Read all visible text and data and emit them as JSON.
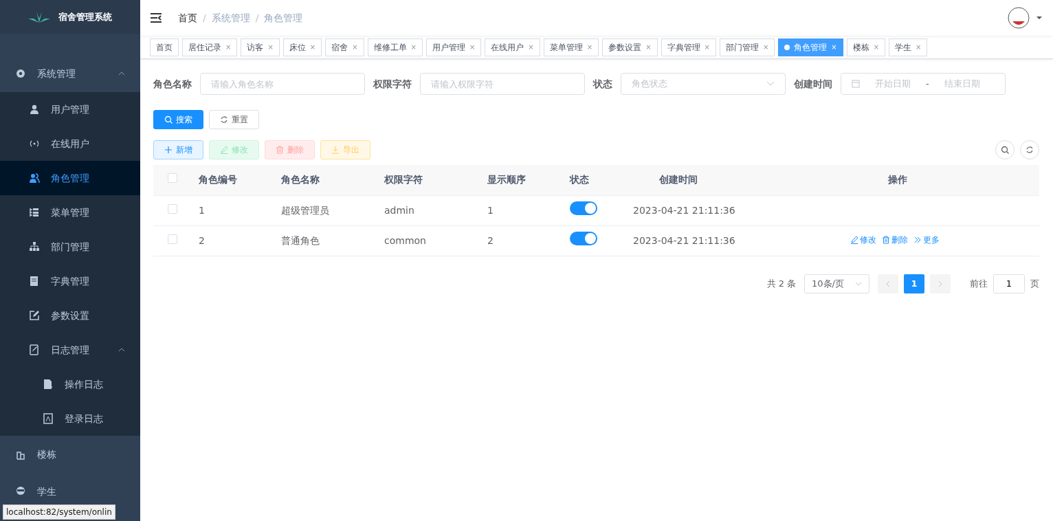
{
  "app": {
    "title": "宿舍管理系统"
  },
  "sidebar": {
    "items": [
      {
        "label": "系统管理",
        "expanded": true,
        "selected": false,
        "children": [
          {
            "label": "用户管理",
            "selected": false
          },
          {
            "label": "在线用户",
            "selected": false
          },
          {
            "label": "角色管理",
            "selected": true
          },
          {
            "label": "菜单管理",
            "selected": false
          },
          {
            "label": "部门管理",
            "selected": false
          },
          {
            "label": "字典管理",
            "selected": false
          },
          {
            "label": "参数设置",
            "selected": false
          },
          {
            "label": "日志管理",
            "expanded": true,
            "selected": false,
            "children": [
              {
                "label": "操作日志",
                "selected": false
              },
              {
                "label": "登录日志",
                "selected": false
              }
            ]
          }
        ]
      },
      {
        "label": "楼栋",
        "selected": false
      },
      {
        "label": "学生",
        "selected": false
      }
    ]
  },
  "breadcrumb": [
    {
      "label": "首页",
      "kind": "link"
    },
    {
      "label": "系统管理",
      "kind": "plain",
      "separator": "/"
    },
    {
      "label": "角色管理",
      "kind": "plain",
      "separator": "/"
    }
  ],
  "tabs": [
    {
      "label": "首页",
      "selected": false
    },
    {
      "label": "居住记录",
      "close": "×",
      "selected": false
    },
    {
      "label": "访客",
      "close": "×",
      "selected": false
    },
    {
      "label": "床位",
      "close": "×",
      "selected": false
    },
    {
      "label": "宿舍",
      "close": "×",
      "selected": false
    },
    {
      "label": "维修工单",
      "close": "×",
      "selected": false
    },
    {
      "label": "用户管理",
      "close": "×",
      "selected": false
    },
    {
      "label": "在线用户",
      "close": "×",
      "selected": false
    },
    {
      "label": "菜单管理",
      "close": "×",
      "selected": false
    },
    {
      "label": "参数设置",
      "close": "×",
      "selected": false
    },
    {
      "label": "字典管理",
      "close": "×",
      "selected": false
    },
    {
      "label": "部门管理",
      "close": "×",
      "selected": false
    },
    {
      "label": "角色管理",
      "close": "×",
      "selected": true
    },
    {
      "label": "楼栋",
      "close": "×",
      "selected": false
    },
    {
      "label": "学生",
      "close": "×",
      "selected": false
    }
  ],
  "filters": [
    {
      "label": "角色名称",
      "kind": "text",
      "placeholder": "请输入角色名称"
    },
    {
      "label": "权限字符",
      "kind": "text",
      "placeholder": "请输入权限字符"
    },
    {
      "label": "状态",
      "kind": "select",
      "placeholder": "角色状态"
    },
    {
      "label": "创建时间",
      "kind": "daterange",
      "start_placeholder": "开始日期",
      "separator": "-",
      "end_placeholder": "结束日期"
    }
  ],
  "search_buttons": [
    {
      "label": "搜索",
      "kind": "primary"
    },
    {
      "label": "重置",
      "kind": "default"
    }
  ],
  "toolbar": [
    {
      "label": "新增",
      "kind": "add"
    },
    {
      "label": "修改",
      "kind": "edit"
    },
    {
      "label": "删除",
      "kind": "delete"
    },
    {
      "label": "导出",
      "kind": "export"
    }
  ],
  "table": {
    "header_checked": false,
    "columns": [
      "角色编号",
      "角色名称",
      "权限字符",
      "显示顺序",
      "状态",
      "创建时间",
      "操作"
    ],
    "rows": [
      {
        "checked": false,
        "id": "1",
        "name": "超级管理员",
        "key": "admin",
        "order": "1",
        "enabled": true,
        "created": "2023-04-21 21:11:36",
        "actions": []
      },
      {
        "checked": false,
        "id": "2",
        "name": "普通角色",
        "key": "common",
        "order": "2",
        "enabled": true,
        "created": "2023-04-21 21:11:36",
        "actions": [
          {
            "label": "修改",
            "kind": "edit"
          },
          {
            "label": "删除",
            "kind": "delete"
          },
          {
            "label": "更多",
            "kind": "more"
          }
        ]
      }
    ]
  },
  "pagination": {
    "total": "共 2 条",
    "page_size": "10条/页",
    "pages": [
      {
        "label": "1",
        "selected": true
      }
    ],
    "goto_label": "前往",
    "goto_value": "1",
    "page_suffix": "页"
  },
  "status_bar": "localhost:82/system/onlin"
}
